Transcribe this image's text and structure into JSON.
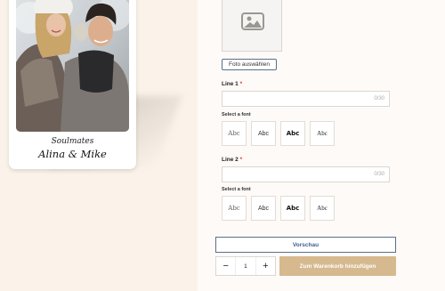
{
  "polaroid": {
    "caption_top": "Soulmates",
    "caption_names": "Alina & Mike"
  },
  "upload": {
    "icon": "image-placeholder-icon",
    "choose_label": "Foto auswählen"
  },
  "line1": {
    "label": "Line 1",
    "required_mark": "*",
    "value": "",
    "counter": "0/30",
    "font_label": "Select a font",
    "font_options": [
      "Abc",
      "Abc",
      "Abc",
      "Abc"
    ]
  },
  "line2": {
    "label": "Line 2",
    "required_mark": "*",
    "value": "",
    "counter": "0/30",
    "font_label": "Select a font",
    "font_options": [
      "Abc",
      "Abc",
      "Abc",
      "Abc"
    ]
  },
  "actions": {
    "preview_label": "Vorschau",
    "minus": "−",
    "quantity": "1",
    "plus": "+",
    "add_to_cart_label": "Zum Warenkorb hinzufügen"
  },
  "colors": {
    "accent": "#d6b98e",
    "link_blue": "#3f5d8f",
    "required": "#d23b3b",
    "background": "#fbf3ea"
  }
}
